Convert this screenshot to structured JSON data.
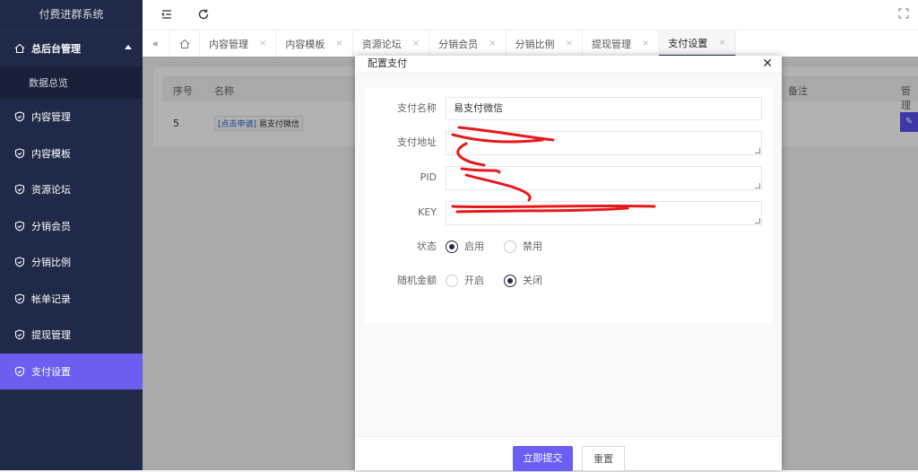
{
  "app_title": "付费进群系统",
  "sidebar": {
    "parent": {
      "label": "总后台管理"
    },
    "sub": {
      "label": "数据总览"
    },
    "items": [
      {
        "label": "内容管理"
      },
      {
        "label": "内容模板"
      },
      {
        "label": "资源论坛"
      },
      {
        "label": "分销会员"
      },
      {
        "label": "分销比例"
      },
      {
        "label": "帐单记录"
      },
      {
        "label": "提现管理"
      },
      {
        "label": "支付设置",
        "active": true
      }
    ]
  },
  "tabs": [
    {
      "label": "内容管理"
    },
    {
      "label": "内容模板"
    },
    {
      "label": "资源论坛"
    },
    {
      "label": "分销会员"
    },
    {
      "label": "分销比例"
    },
    {
      "label": "提现管理"
    },
    {
      "label": "支付设置",
      "active": true
    }
  ],
  "tab_close": "×",
  "table": {
    "headers": {
      "no": "序号",
      "name": "名称",
      "remark": "备注",
      "manage": "管理"
    },
    "rows": [
      {
        "no": "5",
        "apply": "[点击申请]",
        "name": "易支付微信"
      }
    ]
  },
  "modal": {
    "title": "配置支付",
    "close": "✕",
    "fields": {
      "name": {
        "label": "支付名称",
        "value": "易支付微信"
      },
      "address": {
        "label": "支付地址"
      },
      "pid": {
        "label": "PID"
      },
      "key": {
        "label": "KEY"
      }
    },
    "status": {
      "label": "状态",
      "options": [
        "启用",
        "禁用"
      ],
      "selected": "启用"
    },
    "random": {
      "label": "随机金额",
      "options": [
        "开启",
        "关闭"
      ],
      "selected": "关闭"
    },
    "submit": "立即提交",
    "reset": "重置"
  },
  "colors": {
    "sidebar": "#1f2a48",
    "accent": "#6a5ef5",
    "redaction": "#e8191b"
  }
}
